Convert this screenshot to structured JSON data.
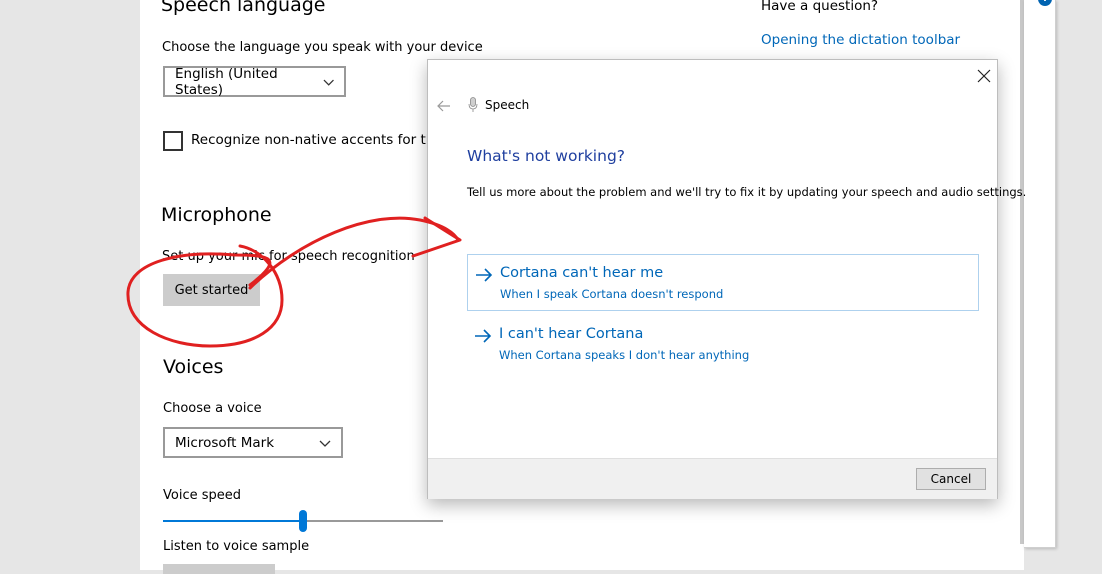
{
  "settings": {
    "speech_language_heading": "Speech language",
    "language_prompt": "Choose the language you speak with your device",
    "language_value": "English (United States)",
    "accents_label": "Recognize non-native accents for this l",
    "microphone_heading": "Microphone",
    "mic_setup_text": "Set up your mic for speech recognition",
    "get_started_label": "Get started",
    "voices_heading": "Voices",
    "choose_voice_label": "Choose a voice",
    "voice_value": "Microsoft Mark",
    "voice_speed_label": "Voice speed",
    "voice_speed_value": 0.5,
    "listen_label": "Listen to voice sample"
  },
  "help": {
    "question": "Have a question?",
    "link": "Opening the dictation toolbar"
  },
  "dialog": {
    "title": "Speech",
    "heading": "What's not working?",
    "description": "Tell us more about the problem and we'll try to fix it by updating your speech and audio settings.",
    "options": [
      {
        "title": "Cortana can't hear me",
        "subtitle": "When I speak Cortana doesn't respond"
      },
      {
        "title": "I can't hear Cortana",
        "subtitle": "When Cortana speaks I don't hear anything"
      }
    ],
    "cancel_label": "Cancel"
  },
  "colors": {
    "accent": "#0078d7",
    "link": "#0067b8",
    "heading_blue": "#1f3f9f",
    "annotation_red": "#e02020"
  },
  "icons": [
    "chevron-down-icon",
    "checkbox-icon",
    "close-icon",
    "back-arrow-icon",
    "microphone-icon",
    "right-arrow-icon",
    "info-icon"
  ]
}
